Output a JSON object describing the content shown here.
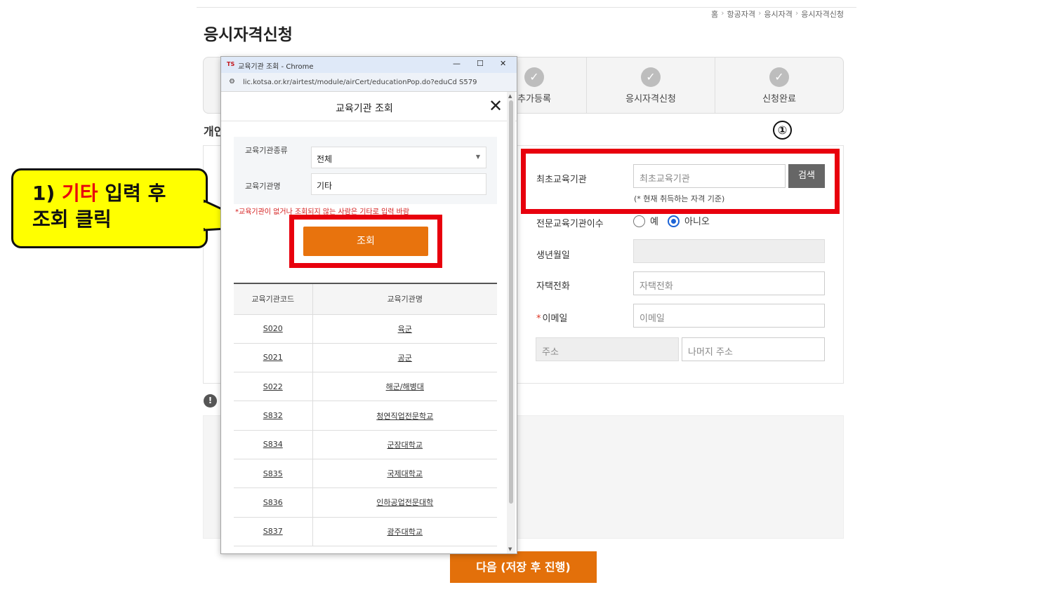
{
  "breadcrumb": {
    "items": [
      "홈",
      "항공자격",
      "응시자격",
      "응시자격신청"
    ],
    "separator": "›"
  },
  "page": {
    "title": "응시자격신청",
    "section_heading": "개인",
    "notice_icon": "!"
  },
  "steps": [
    {
      "label": "추가등록",
      "icon": "check-circle-icon"
    },
    {
      "label": "응시자격신청",
      "icon": "check-circle-icon"
    },
    {
      "label": "신청완료",
      "icon": "check-circle-icon"
    }
  ],
  "annotation": {
    "marker": "①",
    "callout_prefix": "1) ",
    "callout_highlight": "기타",
    "callout_rest": " 입력 후",
    "callout_line2": "조회 클릭",
    "colors": {
      "highlight": "#e8000d",
      "callout_bg": "#ffff00"
    }
  },
  "form": {
    "institution": {
      "label": "최초교육기관",
      "placeholder": "최초교육기관",
      "button": "검색",
      "hint": "(* 현재 취득하는 자격 기준)"
    },
    "specialized": {
      "label": "전문교육기관이수",
      "options": [
        "예",
        "아니오"
      ],
      "selected": "아니오"
    },
    "birth": {
      "label": "생년월일"
    },
    "phone": {
      "label": "자택전화",
      "placeholder": "자택전화"
    },
    "email": {
      "label": "이메일",
      "required_mark": "*",
      "placeholder": "이메일"
    },
    "address": {
      "placeholder": "주소",
      "detail_placeholder": "나머지 주소"
    }
  },
  "next_button": "다음 (저장 후 진행)",
  "popup": {
    "window_title": "교육기관 조회 - Chrome",
    "logo": "TS",
    "url": "lic.kotsa.or.kr/airtest/module/airCert/educationPop.do?eduCd  S579",
    "controls": {
      "minimize": "—",
      "maximize": "☐",
      "close": "✕"
    },
    "title": "교육기관 조회",
    "type_label": "교육기관종류",
    "type_value": "전체",
    "name_label": "교육기관명",
    "name_value": "기타",
    "warning": "*교육기관이 없거나 조회되지 않는 사람은 기타로 입력 바람",
    "query_button": "조회",
    "table": {
      "headers": [
        "교육기관코드",
        "교육기관명"
      ],
      "rows": [
        [
          "S020",
          "육군"
        ],
        [
          "S021",
          "공군"
        ],
        [
          "S022",
          "해군/해병대"
        ],
        [
          "S832",
          "청연직업전문학교"
        ],
        [
          "S834",
          "군장대학교"
        ],
        [
          "S835",
          "국제대학교"
        ],
        [
          "S836",
          "인하공업전문대학"
        ],
        [
          "S837",
          "광주대학교"
        ]
      ]
    }
  }
}
